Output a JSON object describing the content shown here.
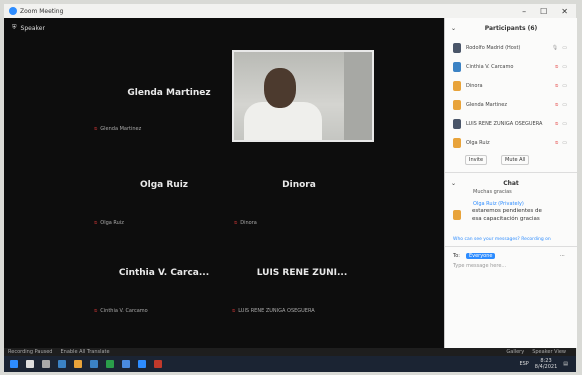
{
  "window": {
    "title": "Zoom Meeting"
  },
  "meeting": {
    "view_label": "Speaker",
    "participants": [
      {
        "name": "Glenda Martinez",
        "sub": "Glenda Martinez"
      },
      {
        "name": "Olga Ruiz",
        "sub": "Olga Ruiz"
      },
      {
        "name": "Dinora",
        "sub": "Dinora"
      },
      {
        "name": "Cinthia V. Carca...",
        "sub": "Cinthia V. Carcamo"
      },
      {
        "name": "LUIS RENE ZUNI...",
        "sub": "LUIS RENE ZUNIGA OSEGUERA"
      }
    ]
  },
  "panel": {
    "participants_title": "Participants (6)",
    "participants": [
      {
        "name": "Rodolfo Madrid (Host)",
        "color": "#4a5568"
      },
      {
        "name": "Cinthia V. Carcamo",
        "color": "#3b82c4"
      },
      {
        "name": "Dinora",
        "color": "#e8a33a"
      },
      {
        "name": "Glenda Martinez",
        "color": "#e8a33a"
      },
      {
        "name": "LUIS RENE ZUNIGA OSEGUERA",
        "color": "#4a5568"
      },
      {
        "name": "Olga Ruiz",
        "color": "#e8a33a"
      }
    ],
    "invite_label": "Invite",
    "mute_all_label": "Mute All",
    "chat_title": "Chat",
    "chat_prev": "Muchas gracias",
    "chat_sender": "Olga Ruiz (Privately)",
    "chat_message": "estaremos pendientes de esa capacitación gracias",
    "chat_note": "Who can see your messages? Recording on",
    "to_label": "To:",
    "to_value": "Everyone",
    "input_placeholder": "Type message here..."
  },
  "statusbar": {
    "left1": "Recording Paused",
    "left2": "Enable All Translate",
    "right1": "Gallery",
    "right2": "Speaker View"
  },
  "taskbar": {
    "time": "8:23",
    "date": "8/4/2021",
    "lang": "ESP"
  }
}
